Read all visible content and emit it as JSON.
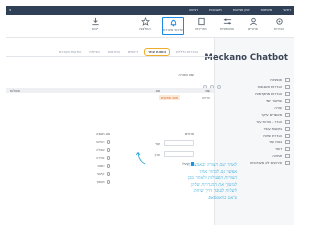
{
  "topbar": {
    "menu": [
      "ראשי",
      "משימות",
      "יומן פגישות",
      "חשבונות",
      "רגישה"
    ],
    "corner": "צ"
  },
  "toolbar": {
    "tools": [
      {
        "label": "הגדרות",
        "icon": "gear-icon"
      },
      {
        "label": "פרטיים",
        "icon": "user-icon"
      },
      {
        "label": "אוטומציות",
        "icon": "sliders-icon"
      },
      {
        "label": "מדריכים",
        "icon": "book-icon"
      },
      {
        "label": "עדכוני מערכת",
        "icon": "bell-icon"
      },
      {
        "label": "המלצות",
        "icon": "star-icon"
      },
      {
        "label": "ייבוא",
        "icon": "import-icon"
      }
    ]
  },
  "sidebar": {
    "title": "Meckano Chatbot",
    "items": [
      {
        "label": "אופציות"
      },
      {
        "label": "הגדרות חשבונות"
      },
      {
        "label": "הגדרות מתקדמות"
      },
      {
        "label": "שרשור יומי"
      },
      {
        "label": "עזרה"
      },
      {
        "label": "מאשרים עיקר"
      },
      {
        "label": "הגדר - צורות עזר"
      },
      {
        "label": "בקשות עובד"
      },
      {
        "label": "הגדרת שדות"
      },
      {
        "label": "בנות עזר"
      },
      {
        "label": "דואר"
      },
      {
        "label": "תמיכה"
      },
      {
        "label": "אירועים לא מעודכנים"
      }
    ]
  },
  "tabs": [
    {
      "label": "הגדרות כלליות",
      "active": false
    },
    {
      "label": "נווטות עוזר",
      "active": true
    },
    {
      "label": "דיווחים",
      "active": false
    },
    {
      "label": "התראות",
      "active": false
    },
    {
      "label": "חבילות",
      "active": false
    },
    {
      "label": "הודעות מערכת",
      "active": false
    }
  ],
  "form": {
    "label_top": "שם הצורה",
    "col_name": "שם",
    "col_type": "סוג",
    "col_actions": "פעולות",
    "row_chip": "מצב מתקדם",
    "row_text": "עריכה",
    "section_title": "פרטים",
    "code_label": "קוד",
    "check_label": "פעיל",
    "sub_label": "סוג תגובה",
    "radios": [
      "הודעה",
      "שאלה",
      "בחירה",
      "טופס",
      "קישור",
      "מסמך"
    ],
    "small_label": "ערך"
  },
  "note": {
    "lines": [
      "לאחר שם הצורה ובאמצעות",
      "אפשר גם לבחור אחד",
      "הצורות הפעילות ולאחר מכן",
      "למשוך את ההגדרות שלהן",
      "לשלוח לעובד דרך שיחת",
      "צ'אט בוואטסאפ"
    ]
  },
  "colors": {
    "topbar": "#2f3f56",
    "accent": "#1e88e5",
    "tab_active_border": "#f0ad2b",
    "note_ink": "#2aa8d8"
  }
}
